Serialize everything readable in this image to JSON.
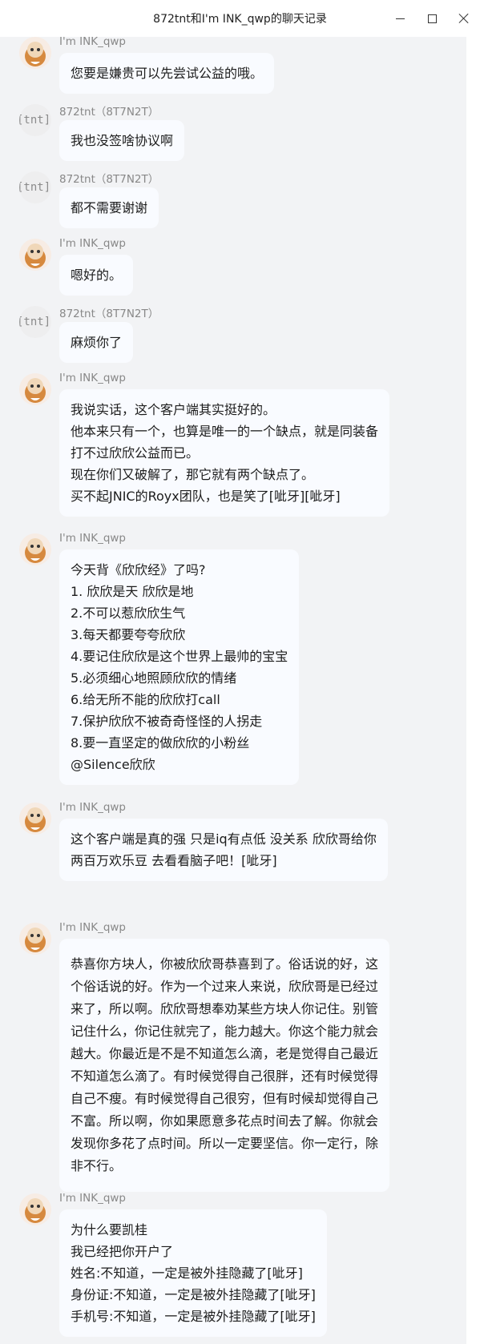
{
  "window": {
    "title": "872tnt和I'm INK_qwp的聊天记录",
    "controls": [
      "minimize",
      "maximize",
      "close"
    ]
  },
  "colors": {
    "chat_background": "#f2f3f5",
    "bubble_background": "#f9fbff",
    "sender_text": "#888888"
  },
  "messages": [
    {
      "sender": "I'm INK_qwp",
      "avatar": "ink-avatar",
      "lines": [
        "您要是嫌贵可以先尝试公益的哦。"
      ]
    },
    {
      "sender": "872tnt（8T7N2T）",
      "avatar": "tnt-avatar",
      "avatar_text": "[tnt]",
      "lines": [
        "我也没签啥协议啊"
      ]
    },
    {
      "sender": "872tnt（8T7N2T）",
      "avatar": "tnt-avatar",
      "avatar_text": "[tnt]",
      "lines": [
        "都不需要谢谢"
      ]
    },
    {
      "sender": "I'm INK_qwp",
      "avatar": "ink-avatar",
      "lines": [
        "嗯好的。"
      ]
    },
    {
      "sender": "872tnt（8T7N2T）",
      "avatar": "tnt-avatar",
      "avatar_text": "[tnt]",
      "lines": [
        "麻烦你了"
      ]
    },
    {
      "sender": "I'm INK_qwp",
      "avatar": "ink-avatar",
      "lines": [
        "我说实话，这个客户端其实挺好的。",
        "他本来只有一个，也算是唯一的一个缺点，就是同装备",
        "打不过欣欣公益而已。",
        "现在你们又破解了，那它就有两个缺点了。",
        "买不起JNIC的Royx团队，也是笑了[呲牙][呲牙]"
      ]
    },
    {
      "sender": "I'm INK_qwp",
      "avatar": "ink-avatar",
      "lines": [
        "今天背《欣欣经》了吗?",
        "1. 欣欣是天 欣欣是地",
        "2.不可以惹欣欣生气",
        "3.每天都要夸夸欣欣",
        "4.要记住欣欣是这个世界上最帅的宝宝",
        "5.必须细心地照顾欣欣的情绪",
        "6.给无所不能的欣欣打call",
        "7.保护欣欣不被奇奇怪怪的人拐走",
        "8.要一直坚定的做欣欣的小粉丝",
        "@Silence欣欣"
      ]
    },
    {
      "sender": "I'm INK_qwp",
      "avatar": "ink-avatar",
      "lines": [
        "这个客户端是真的强 只是iq有点低 没关系 欣欣哥给你",
        "两百万欢乐豆 去看看脑子吧！[呲牙]"
      ]
    },
    {
      "sender": "I'm INK_qwp",
      "avatar": "ink-avatar",
      "lines": [
        "恭喜你方块人，你被欣欣哥恭喜到了。俗话说的好，这",
        "个俗话说的好。作为一个过来人来说，欣欣哥是已经过",
        "来了，所以啊。欣欣哥想奉劝某些方块人你记住。别管",
        "记住什么，你记住就完了，能力越大。你这个能力就会",
        "越大。你最近是不是不知道怎么滴，老是觉得自己最近",
        "不知道怎么滴了。有时候觉得自己很胖，还有时候觉得",
        "自己不瘦。有时候觉得自己很穷，但有时候却觉得自己",
        "不富。所以啊，你如果愿意多花点时间去了解。你就会",
        "发现你多花了点时间。所以一定要坚信。你一定行，除",
        "非不行。"
      ]
    },
    {
      "sender": "I'm INK_qwp",
      "avatar": "ink-avatar",
      "lines": [
        "为什么要凯桂",
        "我已经把你开户了",
        "姓名:不知道，一定是被外挂隐藏了[呲牙]",
        "身份证:不知道，一定是被外挂隐藏了[呲牙]",
        "手机号:不知道，一定是被外挂隐藏了[呲牙]"
      ]
    }
  ]
}
